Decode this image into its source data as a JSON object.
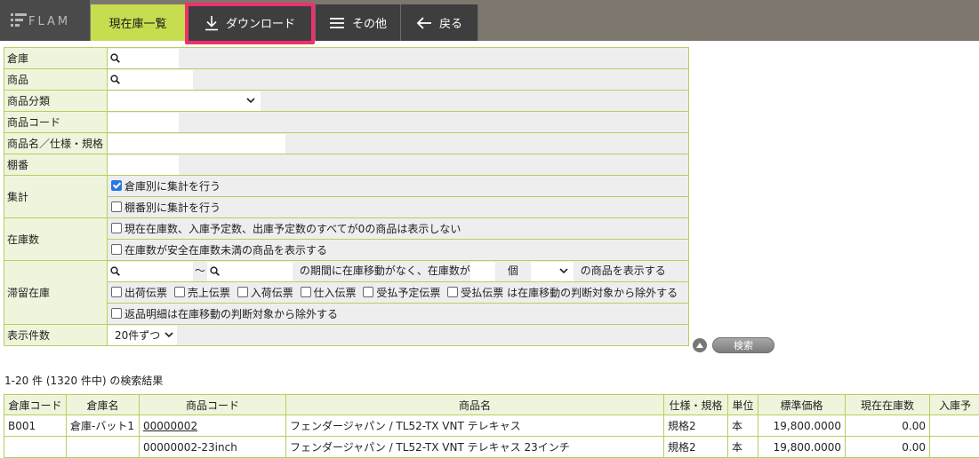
{
  "header": {
    "logo_text": "FLAM",
    "tabs": [
      {
        "label": "現在庫一覧"
      },
      {
        "label": "ダウンロード"
      },
      {
        "label": "その他"
      },
      {
        "label": "戻る"
      }
    ]
  },
  "form": {
    "rows": {
      "warehouse": "倉庫",
      "product": "商品",
      "category": "商品分類",
      "code": "商品コード",
      "name_spec": "商品名／仕様・規格",
      "shelf": "棚番",
      "aggregate": "集計",
      "stock_count": "在庫数",
      "stagnant": "滞留在庫",
      "per_page": "表示件数"
    },
    "aggregate_options": [
      {
        "label": "倉庫別に集計を行う",
        "checked": true
      },
      {
        "label": "棚番別に集計を行う",
        "checked": false
      }
    ],
    "stock_options": [
      {
        "label": "現在在庫数、入庫予定数、出庫予定数のすべてが0の商品は表示しない",
        "checked": false
      },
      {
        "label": "在庫数が安全在庫数未満の商品を表示する",
        "checked": false
      }
    ],
    "stagnant": {
      "tilde": "～",
      "mid_text": "の期間に在庫移動がなく、在庫数が",
      "unit": "個",
      "end_text": "の商品を表示する",
      "slips": [
        "出荷伝票",
        "売上伝票",
        "入荷伝票",
        "仕入伝票",
        "受払予定伝票",
        "受払伝票"
      ],
      "slips_suffix": "は在庫移動の判断対象から除外する",
      "return_label": "返品明細は在庫移動の判断対象から除外する"
    },
    "per_page_value": "20件ずつ",
    "search_button": "検索"
  },
  "results": {
    "summary": "1-20 件 (1320 件中) の検索結果",
    "columns": [
      "倉庫コード",
      "倉庫名",
      "商品コード",
      "商品名",
      "仕様・規格",
      "単位",
      "標準価格",
      "現在在庫数",
      "入庫予"
    ],
    "rows": [
      [
        "B001",
        "倉庫-バット1",
        "00000002",
        "フェンダージャパン / TL52-TX VNT テレキャス",
        "規格2",
        "本",
        "19,800.0000",
        "0.00",
        ""
      ],
      [
        "",
        "",
        "00000002-23inch",
        "フェンダージャパン / TL52-TX VNT テレキャス 23インチ",
        "規格2",
        "本",
        "19,800.0000",
        "0.00",
        ""
      ]
    ]
  }
}
